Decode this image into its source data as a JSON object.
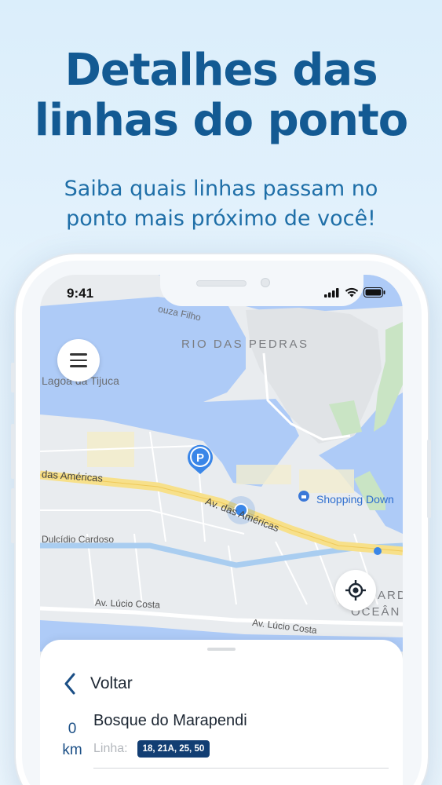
{
  "promo": {
    "headline_line1": "Detalhes das",
    "headline_line2": "linhas do ponto",
    "subhead_line1": "Saiba quais linhas passam no",
    "subhead_line2": "ponto mais próximo de você!"
  },
  "status_bar": {
    "time": "9:41",
    "icons": [
      "signal-icon",
      "wifi-icon",
      "battery-icon"
    ]
  },
  "map": {
    "labels": {
      "souza_filho": "ouza Filho",
      "rio_das_pedras": "RIO DAS PEDRAS",
      "lagoa": "Lagoa da Tijuca",
      "das_americas": "das Américas",
      "av_das_americas": "Av. das Américas",
      "shopping": "Shopping Down",
      "dulcidio": "Dulcídio Cardoso",
      "av_lucio_costa_1": "Av. Lúcio Costa",
      "av_lucio_costa_2": "Av. Lúcio Costa",
      "ard": "ARD",
      "ocean": "OCEÂN"
    },
    "parking_icon": "parking-icon",
    "colors": {
      "water": "#aecbf7",
      "land": "#e9ecef",
      "road_main": "#f7e08a",
      "road_blue": "#a9cdf0",
      "accent": "#1b6ed6"
    }
  },
  "sheet": {
    "back_label": "Voltar",
    "distance_value": "0",
    "distance_unit": "km",
    "stop_name": "Bosque do Marapendi",
    "line_label": "Linha:",
    "lines_badge": "18, 21A, 25, 50"
  }
}
